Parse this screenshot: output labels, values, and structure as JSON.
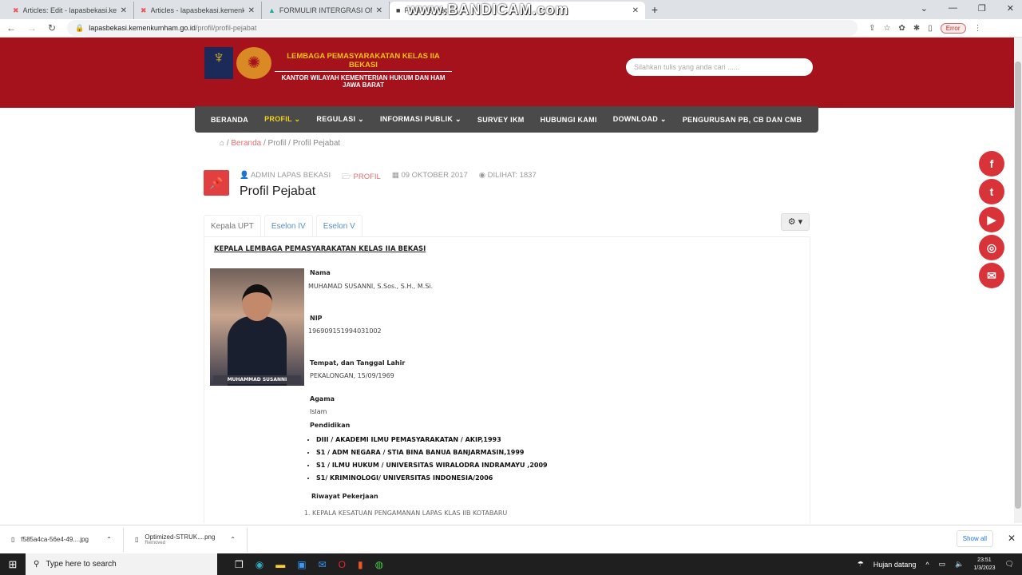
{
  "browser": {
    "tabs": [
      {
        "title": "Articles: Edit - lapasbekasi.kemen",
        "icon": "joomla-icon"
      },
      {
        "title": "Articles - lapasbekasi.kemenkum",
        "icon": "joomla-icon"
      },
      {
        "title": "FORMULIR INTERGRASI ONLINE",
        "icon": "google-drive-icon"
      },
      {
        "title": "Profil Pejabat",
        "icon": "site-favicon",
        "active": true
      }
    ],
    "watermark": "www.BANDICAM.com",
    "url_domain": "lapasbekasi.kemenkumham.go.id",
    "url_path": "/profil/profil-pejabat",
    "profile_status": "Error"
  },
  "header": {
    "title_line1": "LEMBAGA PEMASYARAKATAN KELAS IIA BEKASI",
    "title_line2": "KANTOR WILAYAH KEMENTERIAN HUKUM DAN HAM",
    "title_line3": "JAWA BARAT",
    "search_placeholder": "Silahkan tulis yang anda cari ......",
    "brand_color": "#a6121c"
  },
  "menu": [
    "BERANDA",
    "PROFIL ⌄",
    "REGULASI ⌄",
    "INFORMASI PUBLIK ⌄",
    "SURVEY IKM",
    "HUBUNGI KAMI",
    "DOWNLOAD ⌄",
    "PENGURUSAN PB, CB DAN CMB"
  ],
  "breadcrumb": [
    "Beranda",
    "Profil",
    "Profil Pejabat"
  ],
  "article": {
    "author": "ADMIN LAPAS BEKASI",
    "category": "PROFIL",
    "date": "09 OKTOBER 2017",
    "views": "DILIHAT: 1837",
    "title": "Profil Pejabat"
  },
  "tabs": [
    "Kepala UPT",
    "Eselon IV",
    "Eselon V"
  ],
  "content": {
    "heading": "KEPALA LEMBAGA PEMASYARAKATAN KELAS IIA BEKASI",
    "photo_caption": "MUHAMMAD SUSANNI",
    "nama_label": "Nama",
    "nama": "MUHAMAD SUSANNI, S.Sos., S.H., M.Si.",
    "nip_label": "NIP",
    "nip": "196909151994031002",
    "ttl_label": "Tempat, dan Tanggal Lahir",
    "ttl": "PEKALONGAN, 15/09/1969",
    "agama_label": "Agama",
    "agama": "Islam",
    "pendidikan_label": "Pendidikan",
    "pendidikan": [
      "DIII / AKADEMI ILMU PEMASYARAKATAN / AKIP,1993",
      "S1 /  ADM NEGARA / STIA BINA BANUA BANJARMASIN,1999",
      "S1 / ILMU HUKUM / UNIVERSITAS WIRALODRA INDRAMAYU ,2009",
      "S1/ KRIMINOLOGI/ UNIVERSITAS INDONESIA/2006"
    ],
    "riwayat_label": "Riwayat Pekerjaan",
    "riwayat": [
      "KEPALA KESATUAN PENGAMANAN LAPAS KLAS IIB KOTABARU"
    ]
  },
  "social": [
    "f",
    "t",
    "▶",
    "◎",
    "✉"
  ],
  "downloads": [
    {
      "name": "f585a4ca-56e4-49....jpg",
      "status": ""
    },
    {
      "name": "Optimized-STRUK....png",
      "status": "Removed"
    }
  ],
  "download_show_all": "Show all",
  "taskbar": {
    "search_placeholder": "Type here to search",
    "weather": "Hujan datang",
    "time": "23:51",
    "date": "1/3/2023"
  }
}
